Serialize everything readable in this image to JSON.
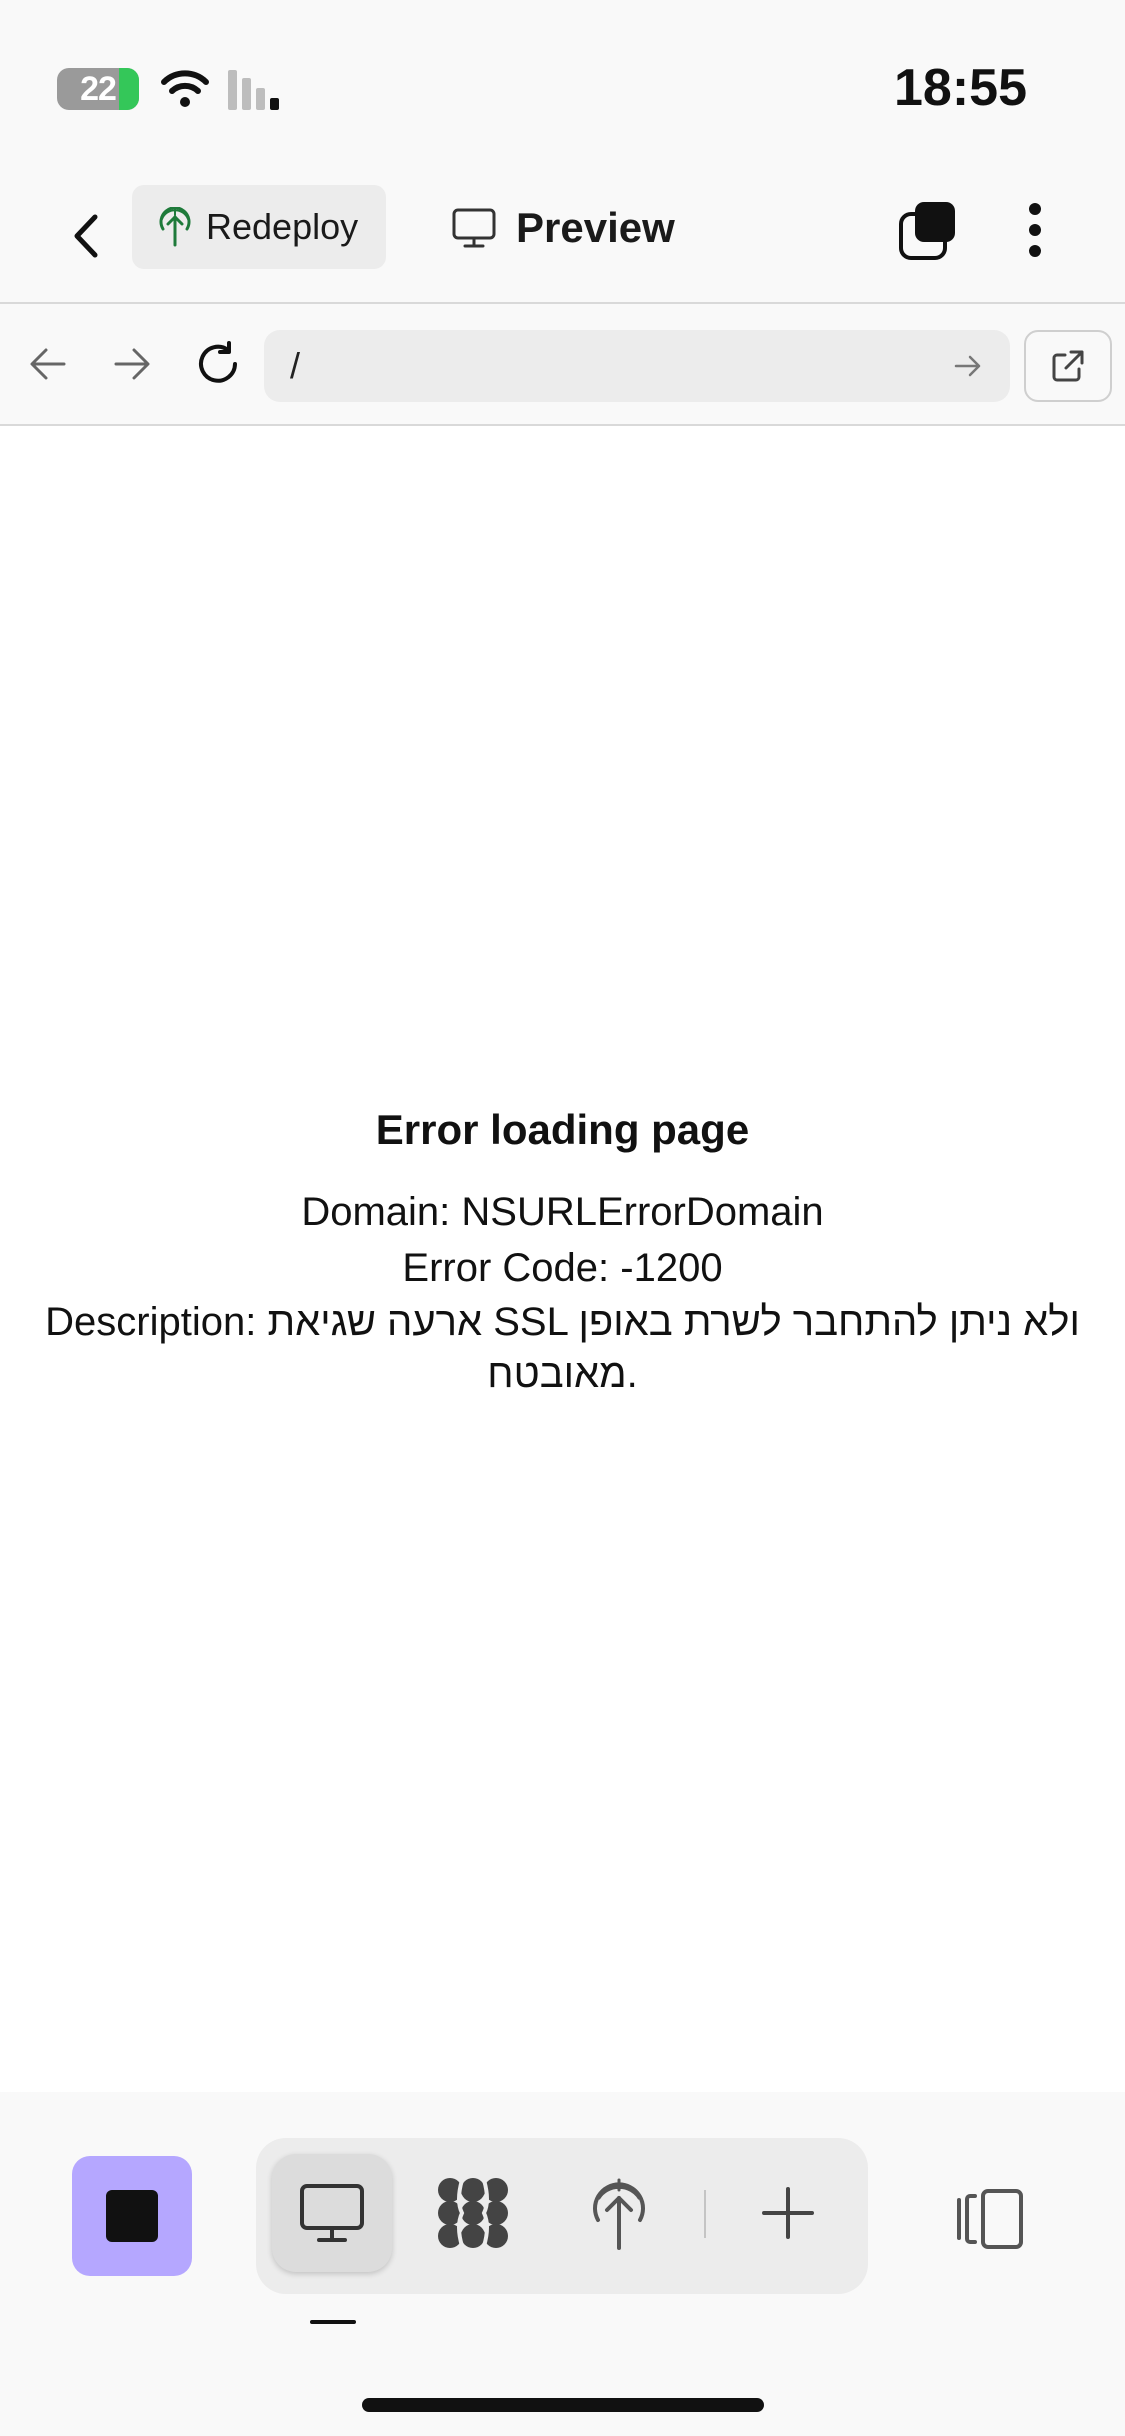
{
  "status_bar": {
    "battery": "22",
    "time": "18:55"
  },
  "header": {
    "redeploy_label": "Redeploy",
    "preview_label": "Preview"
  },
  "url_bar": {
    "url": "/"
  },
  "error": {
    "title": "Error loading page",
    "domain_line": "Domain: NSURLErrorDomain",
    "code_line": "Error Code: -1200",
    "description_line": "Description: ארעה שגיאת SSL ולא ניתן להתחבר לשרת באופן מאובטח."
  },
  "bottom_bar": {
    "stop_color": "#b5a7ff"
  },
  "icons": [
    "back-icon",
    "antenna-icon",
    "monitor-icon",
    "tabs-icon",
    "more-icon",
    "arrow-left-icon",
    "arrow-right-icon",
    "reload-icon",
    "go-icon",
    "external-link-icon",
    "stop-icon",
    "apps-icon",
    "deploy-icon",
    "plus-icon",
    "panel-icon"
  ]
}
